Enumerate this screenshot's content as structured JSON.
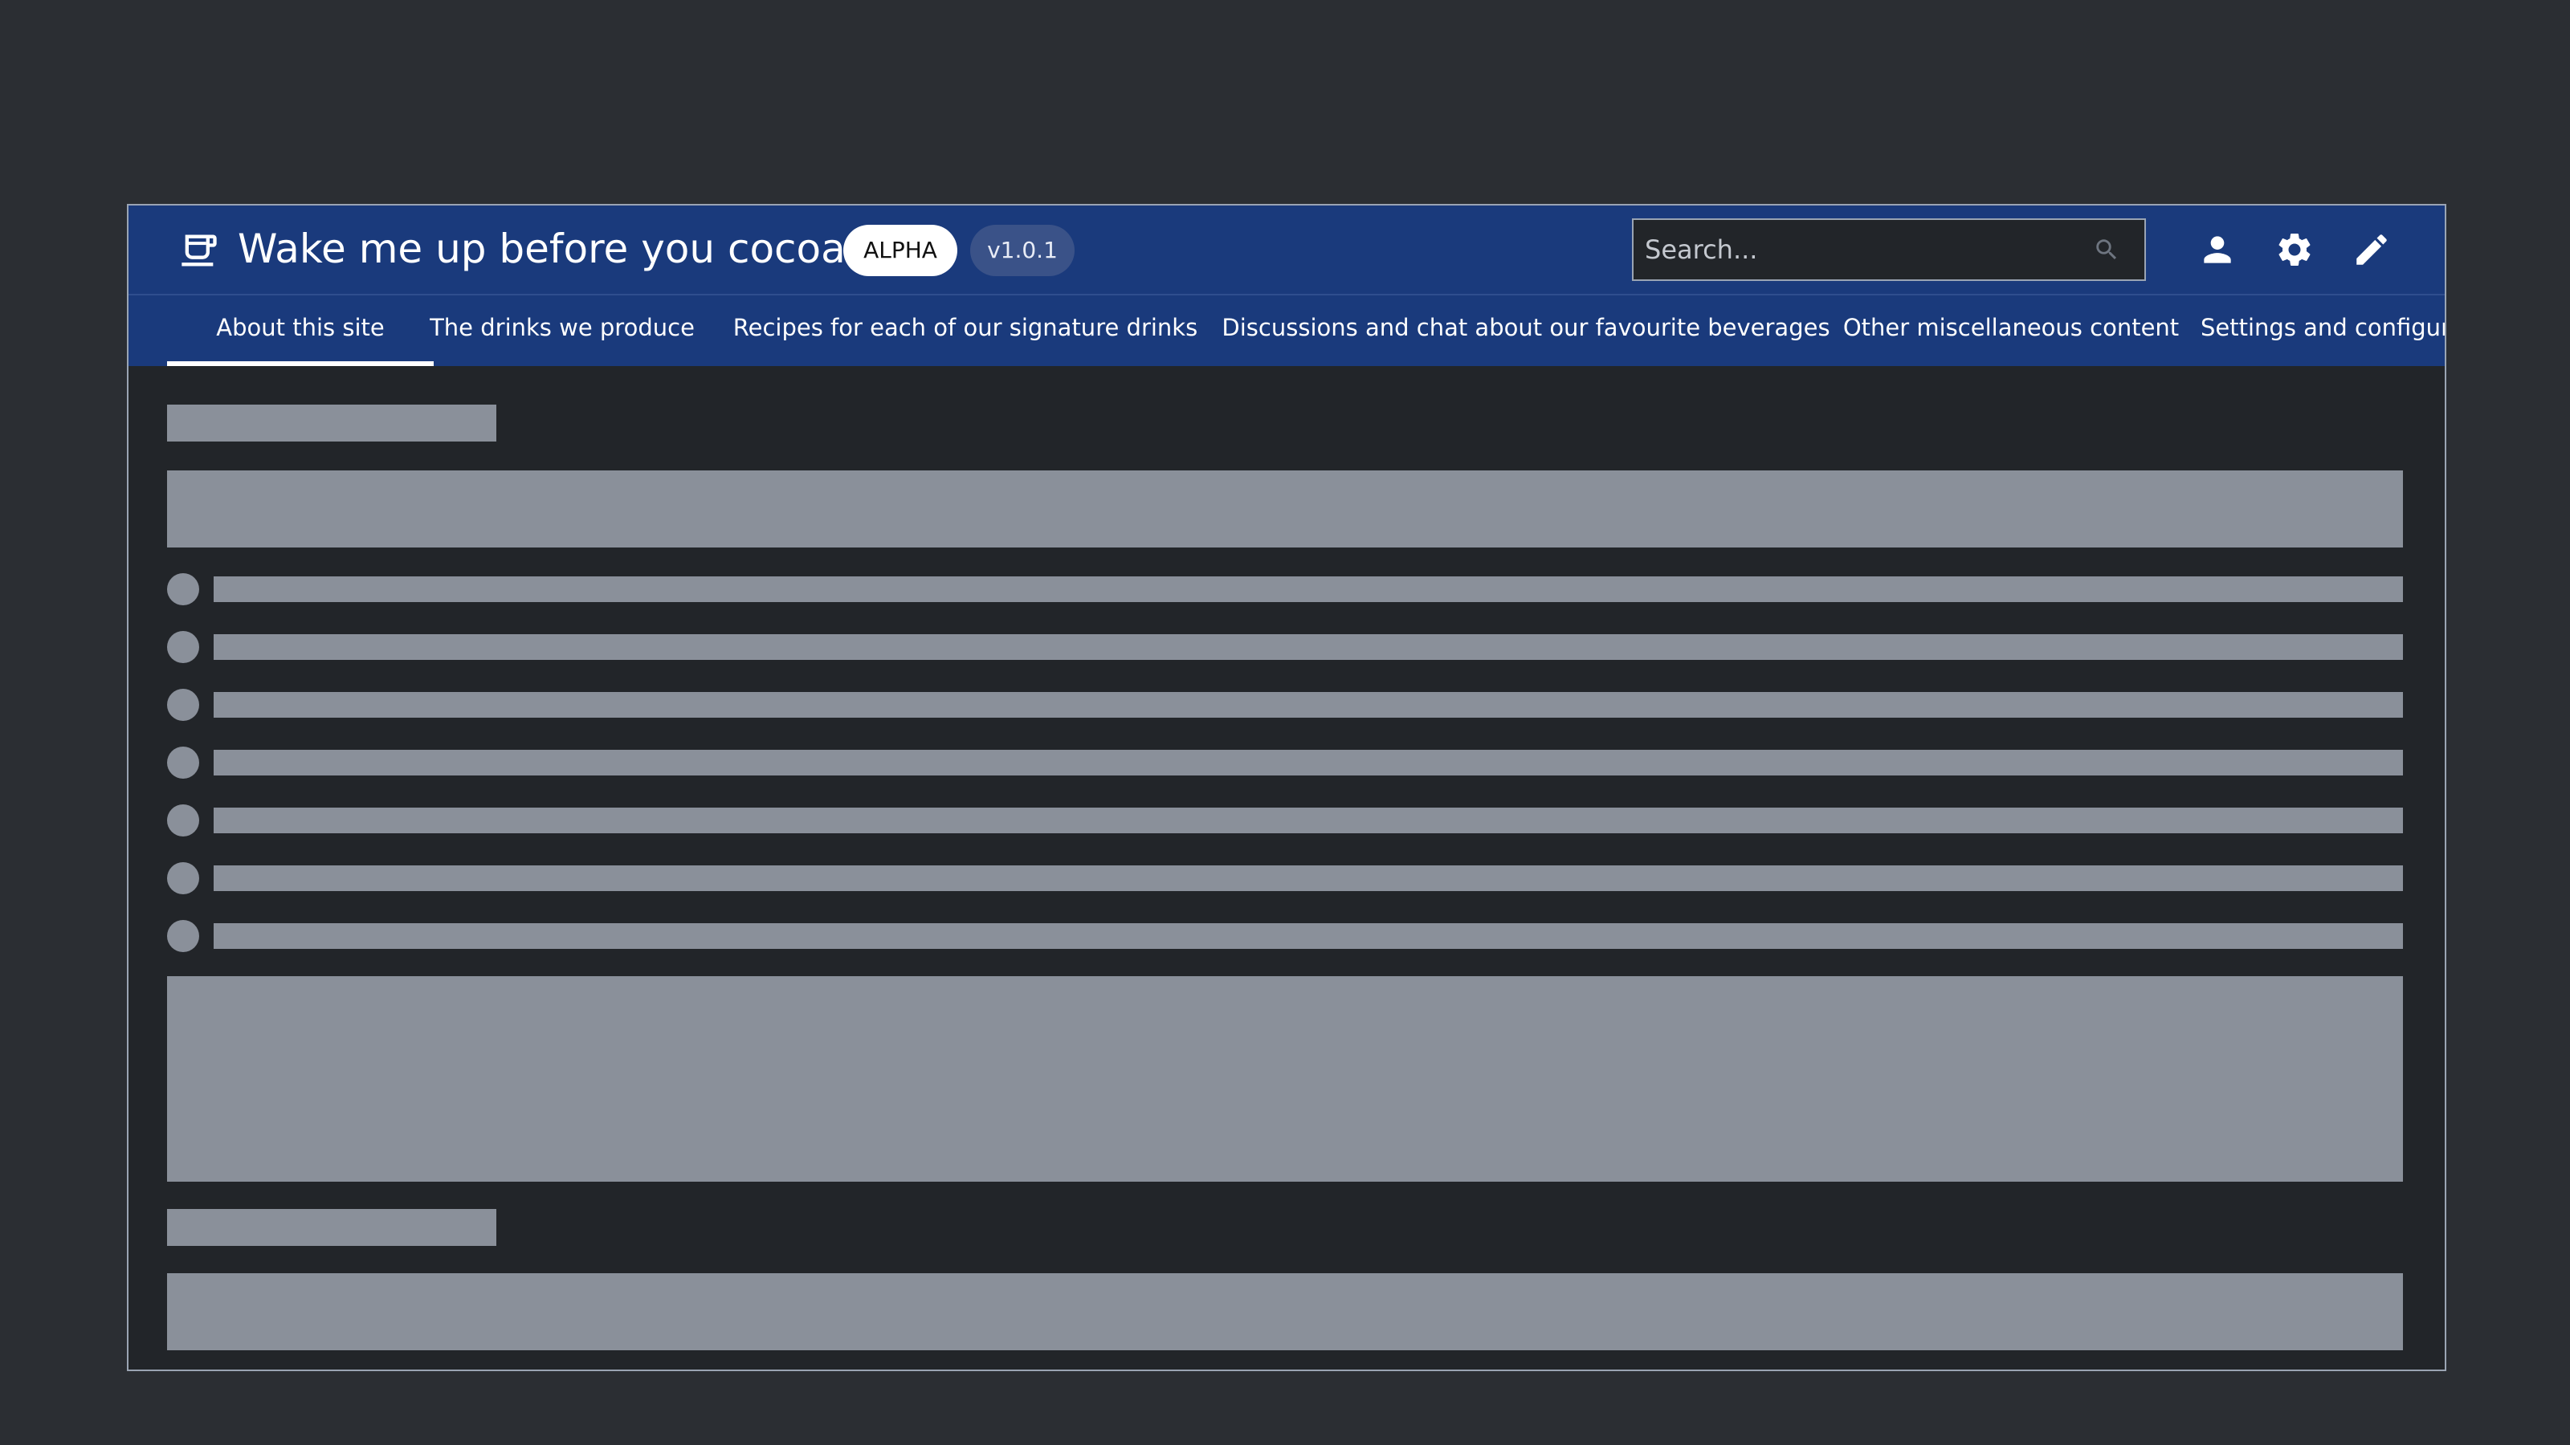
{
  "header": {
    "title": "Wake me up before you cocoa",
    "logo_icon": "coffee-cup-icon",
    "badges": {
      "alpha": "ALPHA",
      "version": "v1.0.1"
    },
    "search": {
      "placeholder": "Search...",
      "value": "",
      "icon": "search-icon"
    },
    "icons": [
      "user-icon",
      "gear-icon",
      "pencil-icon"
    ]
  },
  "nav": {
    "tabs": [
      {
        "label": "About this site",
        "active": true
      },
      {
        "label": "The drinks we produce",
        "active": false
      },
      {
        "label": "Recipes for each of our signature drinks",
        "active": false
      },
      {
        "label": "Discussions and chat about our favourite beverages",
        "active": false
      },
      {
        "label": "Other miscellaneous content",
        "active": false
      },
      {
        "label": "Settings and configuration",
        "active": false
      }
    ]
  },
  "content": {
    "state": "loading-skeleton",
    "skeleton_list_items": 7
  },
  "colors": {
    "page_background": "#2b2e33",
    "header_background": "#1a3a7c",
    "content_background": "#222529",
    "skeleton": "#8a909a",
    "badge_version_background": "#3a5288"
  }
}
